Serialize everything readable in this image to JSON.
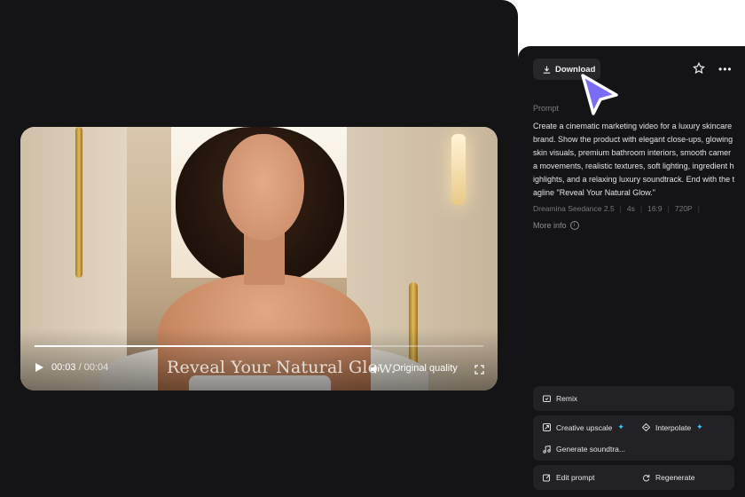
{
  "player": {
    "current_time": "00:03",
    "duration": "/ 00:04",
    "progress": 0.75,
    "caption": "Reveal Your Natural Glow.",
    "quality": "Original quality"
  },
  "toolbar": {
    "download_label": "Download"
  },
  "prompt": {
    "label": "Prompt",
    "text": "Create a cinematic marketing video for a luxury skincare brand. Show the product with elegant close-ups, glowing skin visuals, premium bathroom interiors, smooth camera movements, realistic textures, soft lighting, ingredient highlights, and a relaxing luxury soundtrack. End with the tagline \"Reveal Your Natural Glow.\""
  },
  "meta": {
    "model": "Dreamina Seedance 2.5",
    "length": "4s",
    "ratio": "16:9",
    "resolution": "720P"
  },
  "more_info_label": "More info",
  "actions": {
    "remix": "Remix",
    "creative_upscale": "Creative upscale",
    "interpolate": "Interpolate",
    "generate_soundtrack": "Generate soundtra...",
    "edit_prompt": "Edit prompt",
    "regenerate": "Regenerate"
  },
  "colors": {
    "panel_bg": "#141417",
    "accent_sparkle": "#3cc8ff",
    "cursor": "#7b6cf6"
  }
}
